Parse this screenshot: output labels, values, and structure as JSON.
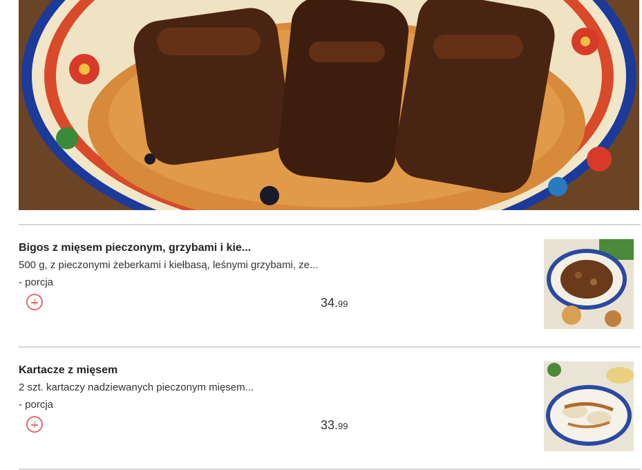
{
  "hero": {
    "image_icon": "roasted-ribs-on-sauerkraut-photo"
  },
  "items": [
    {
      "title": "Bigos z mięsem pieczonym, grzybami i kie...",
      "description": "500 g, z pieczonymi żeberkami i kiełbasą, leśnymi grzybami, ze...",
      "portion": "- porcja",
      "price_main": "34.",
      "price_cents": "99",
      "thumb_icon": "bigos-plate-photo"
    },
    {
      "title": "Kartacze z mięsem",
      "description": "2 szt. kartaczy nadziewanych pieczonym mięsem...",
      "portion": "- porcja",
      "price_main": "33.",
      "price_cents": "99",
      "thumb_icon": "kartacze-plate-photo"
    }
  ],
  "colors": {
    "accent": "#e06a6a",
    "divider": "#d4d4d4"
  }
}
